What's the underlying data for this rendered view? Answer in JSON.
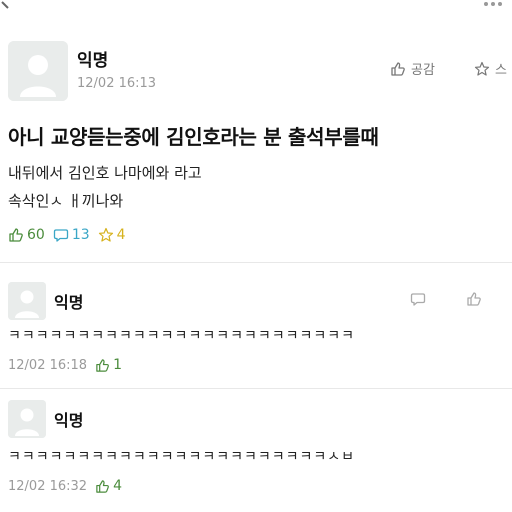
{
  "post": {
    "author": "익명",
    "time": "12/02 16:13",
    "like_label": "공감",
    "scrap_label": "스",
    "title": "아니 교양듣는중에 김인호라는 분 출석부를때",
    "body_lines": [
      "내뒤에서 김인호 나마에와 라고",
      "속삭인ㅅ ㅐ끼나와"
    ],
    "likes": "60",
    "comments": "13",
    "scraps": "4"
  },
  "comments": [
    {
      "author": "익명",
      "text": "ㅋㅋㅋㅋㅋㅋㅋㅋㅋㅋㅋㅋㅋㅋㅋㅋㅋㅋㅋㅋㅋㅋㅋㅋㅋ",
      "time": "12/02 16:18",
      "likes": "1"
    },
    {
      "author": "익명",
      "text": "ㅋㅋㅋㅋㅋㅋㅋㅋㅋㅋㅋㅋㅋㅋㅋㅋㅋㅋㅋㅋㅋㅋㅋㅅㅂ",
      "time": "12/02 16:32",
      "likes": "4"
    }
  ],
  "colors": {
    "like": "#4b8c3c",
    "comment": "#3aa6c6",
    "scrap": "#d6b21d",
    "muted": "#9a9a9a"
  }
}
